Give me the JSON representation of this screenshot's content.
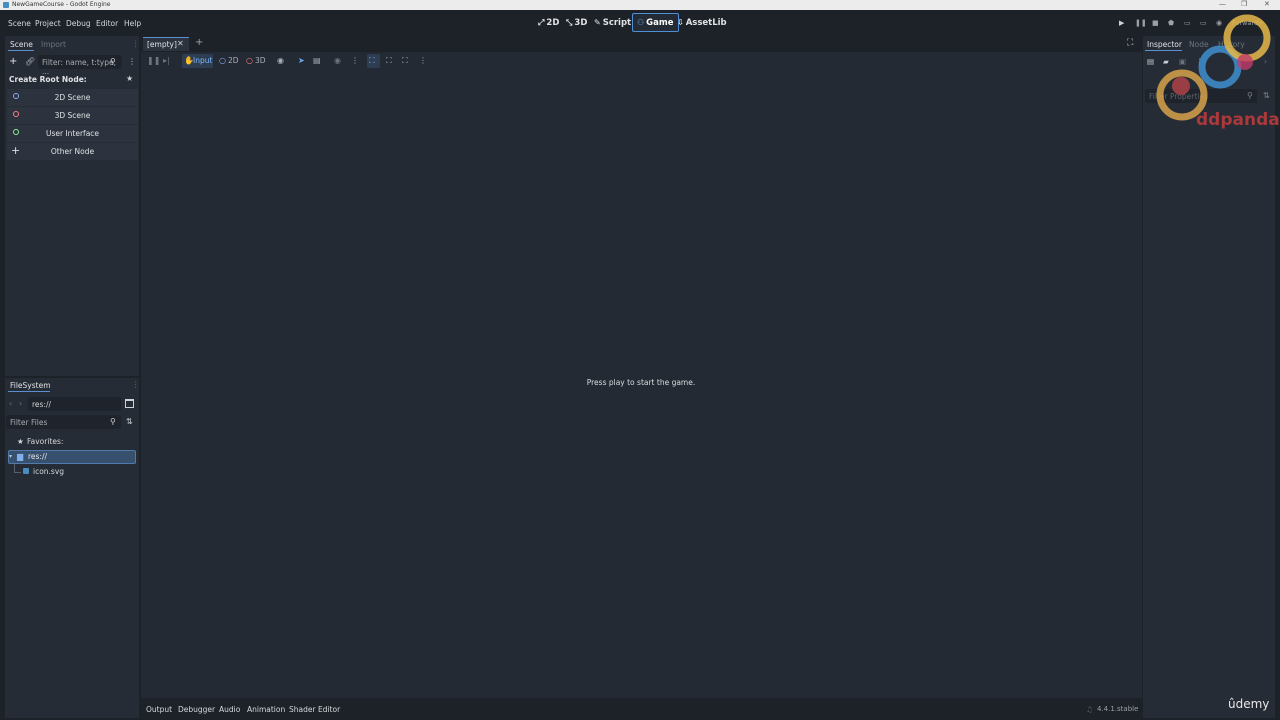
{
  "window": {
    "title": "NewGameCourse - Godot Engine",
    "controls": [
      "—",
      "❐",
      "✕"
    ]
  },
  "menu": [
    "Scene",
    "Project",
    "Debug",
    "Editor",
    "Help"
  ],
  "workspaces": [
    {
      "icon": "2d-icon",
      "glyph": "⤢",
      "label": "2D"
    },
    {
      "icon": "3d-icon",
      "glyph": "⤡",
      "label": "3D"
    },
    {
      "icon": "script-icon",
      "glyph": "✎",
      "label": "Script"
    },
    {
      "icon": "game-icon",
      "glyph": "⚇",
      "label": "Game",
      "active": true
    },
    {
      "icon": "assetlib-icon",
      "glyph": "⇩",
      "label": "AssetLib"
    }
  ],
  "renderer": "Forward+",
  "scene_dock": {
    "tabs": [
      "Scene",
      "Import"
    ],
    "filter_placeholder": "Filter: name, t:type, ...",
    "create_root_label": "Create Root Node:",
    "root_options": [
      {
        "label": "2D Scene",
        "color": "#8da5f3"
      },
      {
        "label": "3D Scene",
        "color": "#fc7f7f"
      },
      {
        "label": "User Interface",
        "color": "#8eef97"
      },
      {
        "label": "Other Node",
        "color": "#e0e0e0"
      }
    ]
  },
  "filesystem": {
    "title": "FileSystem",
    "path": "res://",
    "filter_placeholder": "Filter Files",
    "favorites_label": "Favorites:",
    "root": "res://",
    "files": [
      "icon.svg"
    ]
  },
  "editor": {
    "tab_label": "[empty]",
    "toolbar": {
      "input": "Input",
      "two_d": "2D",
      "three_d": "3D"
    },
    "message": "Press play to start the game."
  },
  "bottom_tabs": [
    "Output",
    "Debugger",
    "Audio",
    "Animation",
    "Shader Editor"
  ],
  "version": "4.4.1.stable",
  "inspector": {
    "tabs": [
      "Inspector",
      "Node",
      "History"
    ],
    "filter_placeholder": "Filter Properties"
  },
  "watermark": {
    "brand": "ddpanda",
    "udemy": "ûdemy"
  },
  "colors": {
    "accent": "#4f8fd6",
    "bg": "#1d2229",
    "panel": "#262c36"
  }
}
